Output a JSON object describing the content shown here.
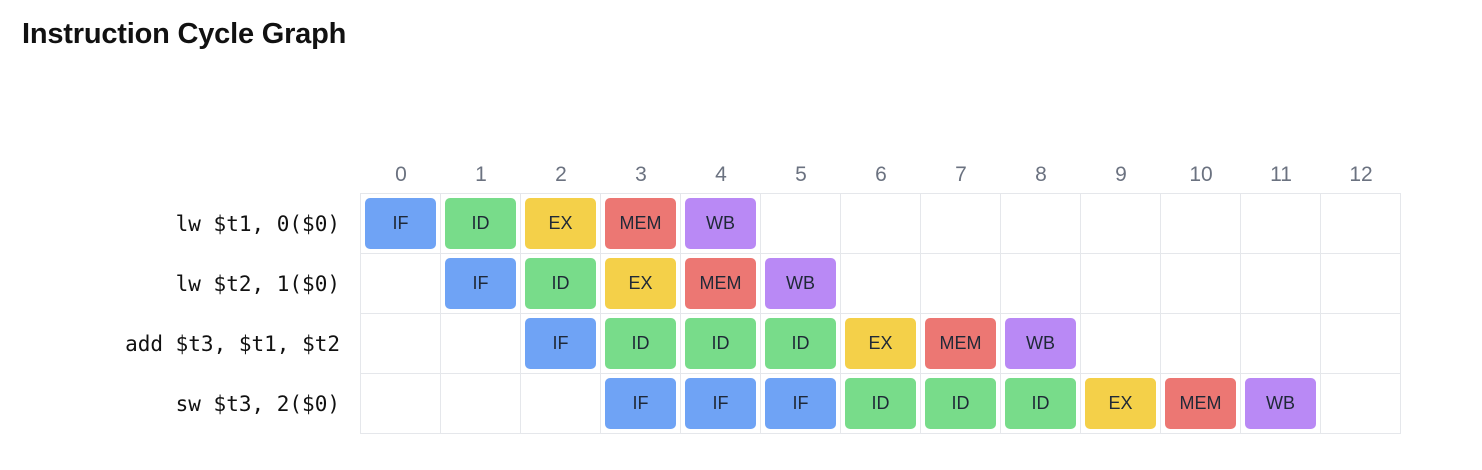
{
  "title": "Instruction Cycle Graph",
  "cycles": [
    "0",
    "1",
    "2",
    "3",
    "4",
    "5",
    "6",
    "7",
    "8",
    "9",
    "10",
    "11",
    "12"
  ],
  "instructions": [
    {
      "label": "lw $t1, 0($0)",
      "stages": [
        {
          "cycle": 0,
          "stage": "IF"
        },
        {
          "cycle": 1,
          "stage": "ID"
        },
        {
          "cycle": 2,
          "stage": "EX"
        },
        {
          "cycle": 3,
          "stage": "MEM"
        },
        {
          "cycle": 4,
          "stage": "WB"
        }
      ]
    },
    {
      "label": "lw $t2, 1($0)",
      "stages": [
        {
          "cycle": 1,
          "stage": "IF"
        },
        {
          "cycle": 2,
          "stage": "ID"
        },
        {
          "cycle": 3,
          "stage": "EX"
        },
        {
          "cycle": 4,
          "stage": "MEM"
        },
        {
          "cycle": 5,
          "stage": "WB"
        }
      ]
    },
    {
      "label": "add $t3, $t1, $t2",
      "stages": [
        {
          "cycle": 2,
          "stage": "IF"
        },
        {
          "cycle": 3,
          "stage": "ID"
        },
        {
          "cycle": 4,
          "stage": "ID"
        },
        {
          "cycle": 5,
          "stage": "ID"
        },
        {
          "cycle": 6,
          "stage": "EX"
        },
        {
          "cycle": 7,
          "stage": "MEM"
        },
        {
          "cycle": 8,
          "stage": "WB"
        }
      ]
    },
    {
      "label": "sw $t3, 2($0)",
      "stages": [
        {
          "cycle": 3,
          "stage": "IF"
        },
        {
          "cycle": 4,
          "stage": "IF"
        },
        {
          "cycle": 5,
          "stage": "IF"
        },
        {
          "cycle": 6,
          "stage": "ID"
        },
        {
          "cycle": 7,
          "stage": "ID"
        },
        {
          "cycle": 8,
          "stage": "ID"
        },
        {
          "cycle": 9,
          "stage": "EX"
        },
        {
          "cycle": 10,
          "stage": "MEM"
        },
        {
          "cycle": 11,
          "stage": "WB"
        }
      ]
    }
  ],
  "stage_colors": {
    "IF": "#6fa3f5",
    "ID": "#78dc8a",
    "EX": "#f4d049",
    "MEM": "#ec7773",
    "WB": "#b989f5"
  }
}
